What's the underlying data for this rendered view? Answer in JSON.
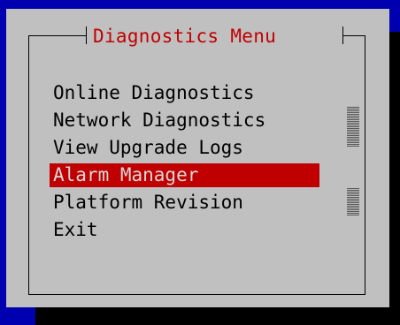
{
  "dialog": {
    "title": "Diagnostics Menu"
  },
  "menu": {
    "items": [
      {
        "label": "Online Diagnostics",
        "selected": false
      },
      {
        "label": "Network Diagnostics",
        "selected": false
      },
      {
        "label": "View Upgrade Logs",
        "selected": false
      },
      {
        "label": "Alarm Manager",
        "selected": true
      },
      {
        "label": "Platform Revision",
        "selected": false
      },
      {
        "label": "Exit",
        "selected": false
      }
    ]
  },
  "colors": {
    "background": "#0000b0",
    "dialog": "#c0c0c0",
    "title_text": "#c00000",
    "highlight": "#c00000",
    "highlight_text": "#d8d8d8"
  }
}
